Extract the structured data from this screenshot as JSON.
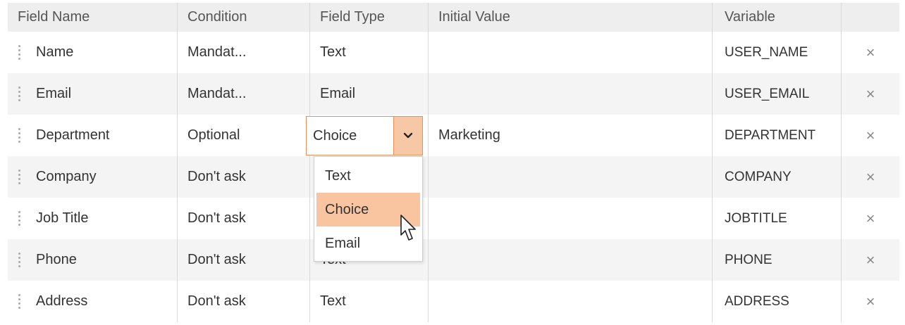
{
  "columns": {
    "field_name": "Field Name",
    "condition": "Condition",
    "field_type": "Field Type",
    "initial_value": "Initial Value",
    "variable": "Variable"
  },
  "rows": [
    {
      "name": "Name",
      "condition": "Mandat...",
      "type": "Text",
      "initial": "",
      "variable": "USER_NAME"
    },
    {
      "name": "Email",
      "condition": "Mandat...",
      "type": "Email",
      "initial": "",
      "variable": "USER_EMAIL"
    },
    {
      "name": "Department",
      "condition": "Optional",
      "type": "",
      "initial": "Marketing",
      "variable": "DEPARTMENT"
    },
    {
      "name": "Company",
      "condition": "Don't ask",
      "type": "",
      "initial": "",
      "variable": "COMPANY"
    },
    {
      "name": "Job Title",
      "condition": "Don't ask",
      "type": "",
      "initial": "",
      "variable": "JOBTITLE"
    },
    {
      "name": "Phone",
      "condition": "Don't ask",
      "type": "Text",
      "initial": "",
      "variable": "PHONE"
    },
    {
      "name": "Address",
      "condition": "Don't ask",
      "type": "Text",
      "initial": "",
      "variable": "ADDRESS"
    }
  ],
  "delete_glyph": "×",
  "field_type_select": {
    "value": "Choice",
    "options": [
      "Text",
      "Choice",
      "Email"
    ],
    "selected_index": 1
  },
  "colors": {
    "accent_border": "#e8915a",
    "arrow_bg": "#f6c8a6",
    "selected_option_bg": "#f9c4a0"
  }
}
